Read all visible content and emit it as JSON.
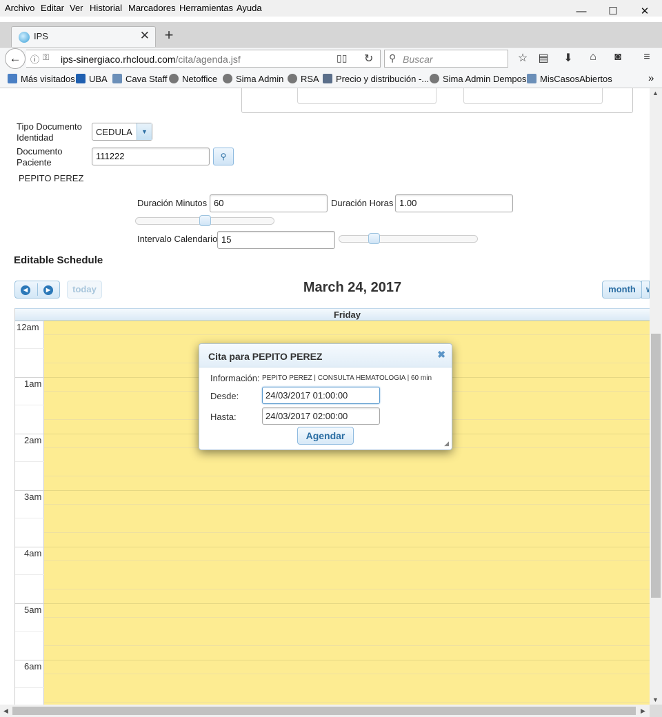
{
  "menubar": {
    "items": [
      "Archivo",
      "Editar",
      "Ver",
      "Historial",
      "Marcadores",
      "Herramientas",
      "Ayuda"
    ]
  },
  "window_controls": {
    "minimize": "—",
    "maximize": "☐",
    "close": "✕"
  },
  "tab": {
    "title": "IPS",
    "close": "✕",
    "new_tab": "+"
  },
  "navbar": {
    "back": "←",
    "url_host": "ips-sinergiaco.rhcloud.com",
    "url_path": "/cita/agenda.jsf",
    "search_placeholder": "Buscar"
  },
  "bookmarks": [
    "Más visitados",
    "UBA",
    "Cava Staff",
    "Netoffice",
    "Sima Admin",
    "RSA",
    "Precio y distribución -...",
    "Sima Admin Dempos",
    "MisCasosAbiertos"
  ],
  "bookmarks_overflow": "»",
  "form": {
    "tipo_doc_label_1": "Tipo Documento",
    "tipo_doc_label_2": "Identidad",
    "tipo_doc_value": "CEDULA",
    "doc_label_1": "Documento",
    "doc_label_2": "Paciente",
    "doc_value": "111222",
    "patient_name": "PEPITO PEREZ",
    "duracion_minutos_label": "Duración Minutos",
    "duracion_minutos_value": "60",
    "duracion_horas_label": "Duración Horas",
    "duracion_horas_value": "1.00",
    "intervalo_label": "Intervalo Calendario",
    "intervalo_value": "15",
    "duracion_slider_level": 0.5,
    "intervalo_slider_level": 0.25
  },
  "schedule": {
    "heading": "Editable Schedule",
    "today_label": "today",
    "date_title": "March 24, 2017",
    "month_label": "month",
    "next_view_label": "w",
    "day_header": "Friday",
    "hours": [
      "12am",
      "1am",
      "2am",
      "3am",
      "4am",
      "5am",
      "6am"
    ]
  },
  "dialog": {
    "title": "Cita para PEPITO PEREZ",
    "info_label": "Información:",
    "info_value": "PEPITO PEREZ | CONSULTA HEMATOLOGIA | 60 min",
    "desde_label": "Desde:",
    "desde_value": "24/03/2017 01:00:00",
    "hasta_label": "Hasta:",
    "hasta_value": "24/03/2017 02:00:00",
    "submit_label": "Agendar"
  },
  "colors": {
    "accent": "#2b6ea3",
    "calendar_bg": "#fdec92"
  }
}
